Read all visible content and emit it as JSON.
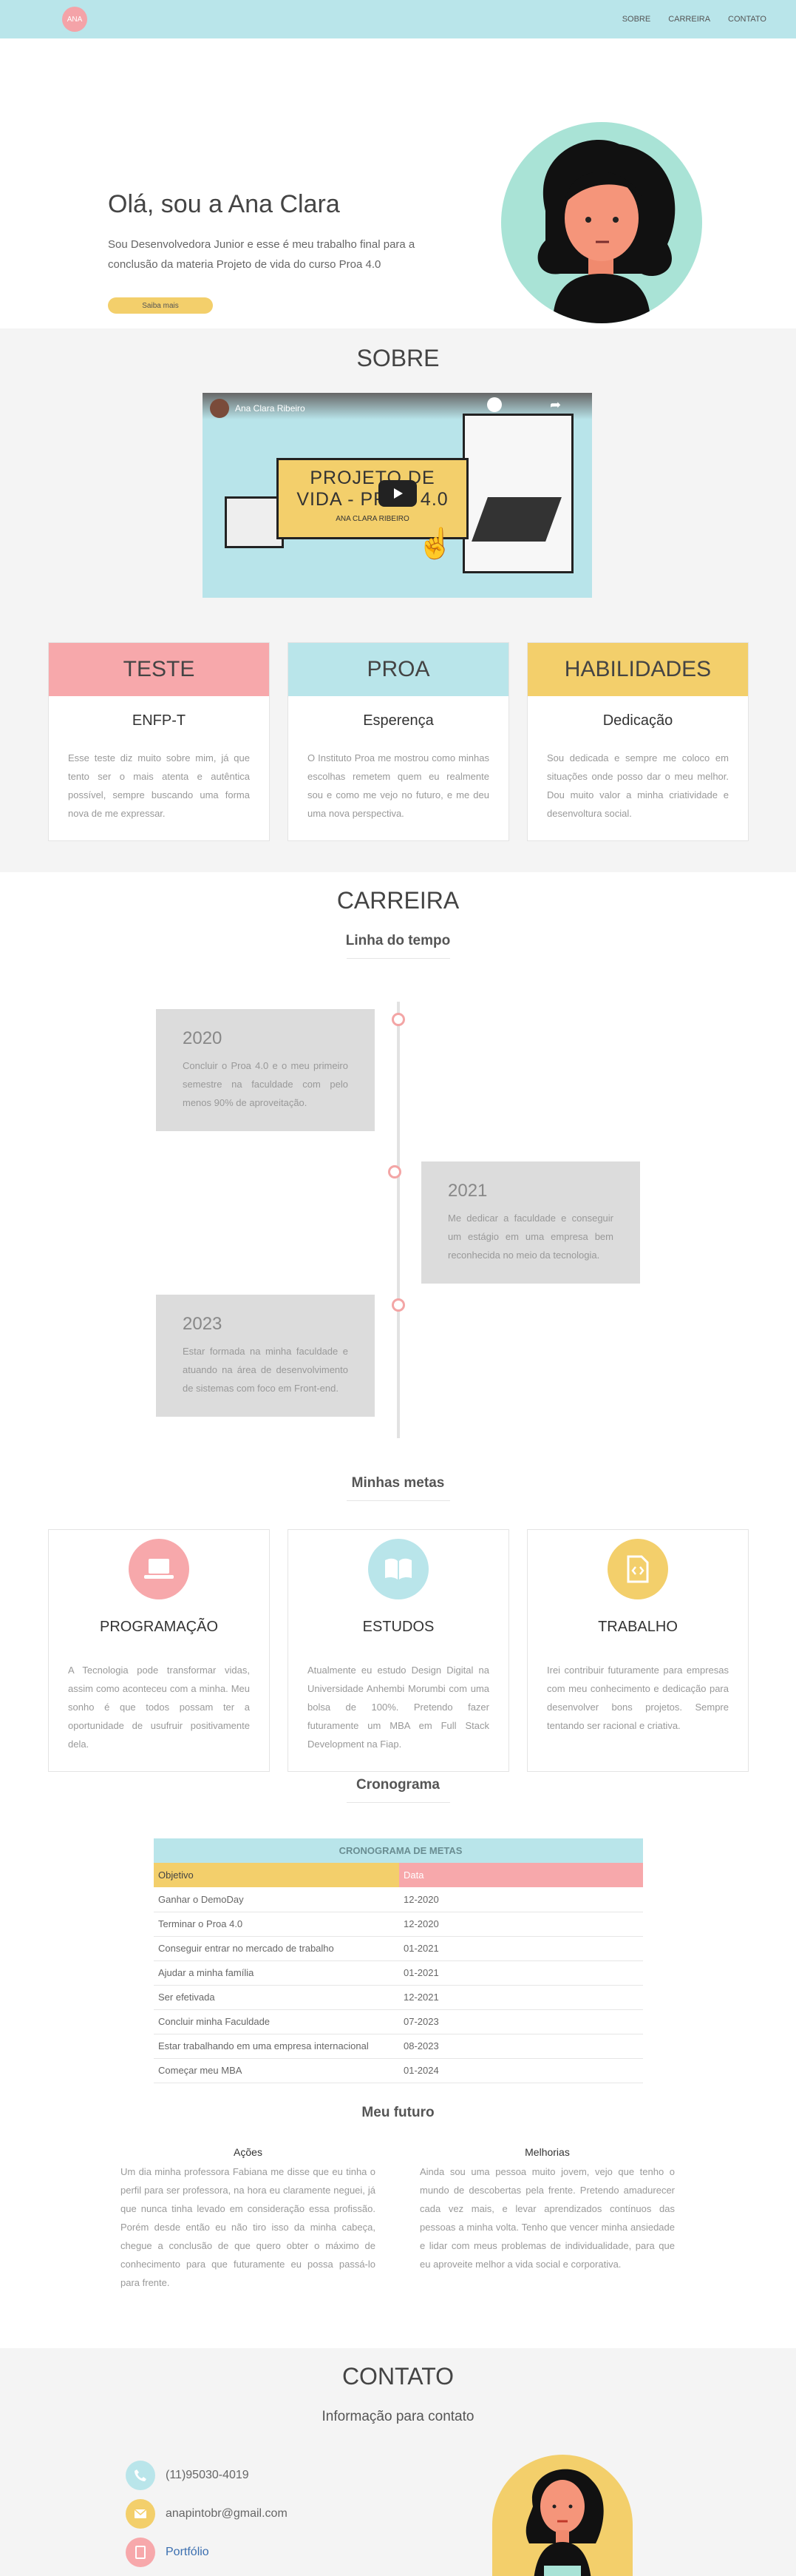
{
  "nav": {
    "logo": "ANA",
    "links": [
      "SOBRE",
      "CARREIRA",
      "CONTATO"
    ]
  },
  "hero": {
    "title": "Olá, sou a Ana Clara",
    "text": "Sou Desenvolvedora Junior e esse é meu trabalho final para a conclusão da materia Projeto de vida do curso Proa 4.0",
    "button": "Saiba mais"
  },
  "sobre": {
    "title": "SOBRE",
    "video": {
      "channel": "Ana Clara Ribeiro",
      "line1": "PROJETO DE",
      "line2": "VIDA - PROA 4.0",
      "subtitle": "ANA CLARA RIBEIRO"
    },
    "cards": [
      {
        "head": "TESTE",
        "color": "#f7a8ab",
        "title": "ENFP-T",
        "text": "Esse teste diz muito sobre mim, já que tento ser o mais atenta e autêntica possível, sempre buscando uma forma nova de me expressar."
      },
      {
        "head": "PROA",
        "color": "#b9e5ea",
        "title": "Esperença",
        "text": "O Instituto Proa me mostrou como minhas escolhas remetem quem eu realmente sou e como me vejo no futuro, e me deu uma nova perspectiva."
      },
      {
        "head": "HABILIDADES",
        "color": "#f3cf6b",
        "title": "Dedicação",
        "text": "Sou dedicada e sempre me coloco em situações onde posso dar o meu melhor. Dou muito valor a minha criatividade e desenvoltura social."
      }
    ]
  },
  "carreira": {
    "title": "CARREIRA",
    "timeline_title": "Linha do tempo",
    "timeline": [
      {
        "year": "2020",
        "text": "Concluir o Proa 4.0 e o meu primeiro semestre na faculdade com pelo menos 90% de aproveitação."
      },
      {
        "year": "2021",
        "text": "Me dedicar a faculdade e conseguir um estágio em uma empresa bem reconhecida no meio da tecnologia."
      },
      {
        "year": "2023",
        "text": "Estar formada na minha faculdade e atuando na área de desenvolvimento de sistemas com foco em Front-end."
      }
    ],
    "goals_title": "Minhas metas",
    "goals": [
      {
        "title": "PROGRAMAÇÃO",
        "icon": "laptop-icon",
        "color": "#f7a8ab",
        "text": "A Tecnologia pode transformar vidas, assim como aconteceu com a minha. Meu sonho é que todos possam ter a oportunidade de usufruir positivamente dela."
      },
      {
        "title": "ESTUDOS",
        "icon": "book-icon",
        "color": "#b9e5ea",
        "text": "Atualmente eu estudo Design Digital na Universidade Anhembi Morumbi com uma bolsa de 100%. Pretendo fazer futuramente um MBA em Full Stack Development na Fiap."
      },
      {
        "title": "TRABALHO",
        "icon": "code-file-icon",
        "color": "#f3cf6b",
        "text": "Irei contribuir futuramente para empresas com meu conhecimento e dedicação para desenvolver bons projetos. Sempre tentando ser racional e criativa."
      }
    ],
    "schedule_title": "Cronograma",
    "schedule": {
      "caption": "CRONOGRAMA DE METAS",
      "headers": [
        "Objetivo",
        "Data"
      ],
      "rows": [
        [
          "Ganhar o DemoDay",
          "12-2020"
        ],
        [
          "Terminar o Proa 4.0",
          "12-2020"
        ],
        [
          "Conseguir entrar no mercado de trabalho",
          "01-2021"
        ],
        [
          "Ajudar a minha família",
          "01-2021"
        ],
        [
          "Ser efetivada",
          "12-2021"
        ],
        [
          "Concluir minha Faculdade",
          "07-2023"
        ],
        [
          "Estar trabalhando em uma empresa internacional",
          "08-2023"
        ],
        [
          "Começar meu MBA",
          "01-2024"
        ]
      ]
    },
    "future_title": "Meu futuro",
    "future": [
      {
        "title": "Ações",
        "text": "Um dia minha professora Fabiana me disse que eu tinha o perfil para ser professora, na hora eu claramente neguei, já que nunca tinha levado em consideração essa profissão. Porém desde então eu não tiro isso da minha cabeça, chegue a conclusão de que quero obter o máximo de conhecimento para que futuramente eu possa passá-lo para frente."
      },
      {
        "title": "Melhorias",
        "text": "Ainda sou uma pessoa muito jovem, vejo que tenho o mundo de descobertas pela frente. Pretendo amadurecer cada vez mais, e levar aprendizados contínuos das pessoas a minha volta. Tenho que vencer minha ansiedade e lidar com meus problemas de individualidade, para que eu aproveite melhor a vida social e corporativa."
      }
    ]
  },
  "contato": {
    "title": "CONTATO",
    "subtitle": "Informação para contato",
    "phone": "(11)95030-4019",
    "email": "anapintobr@gmail.com",
    "portfolio": "Portfólio"
  }
}
